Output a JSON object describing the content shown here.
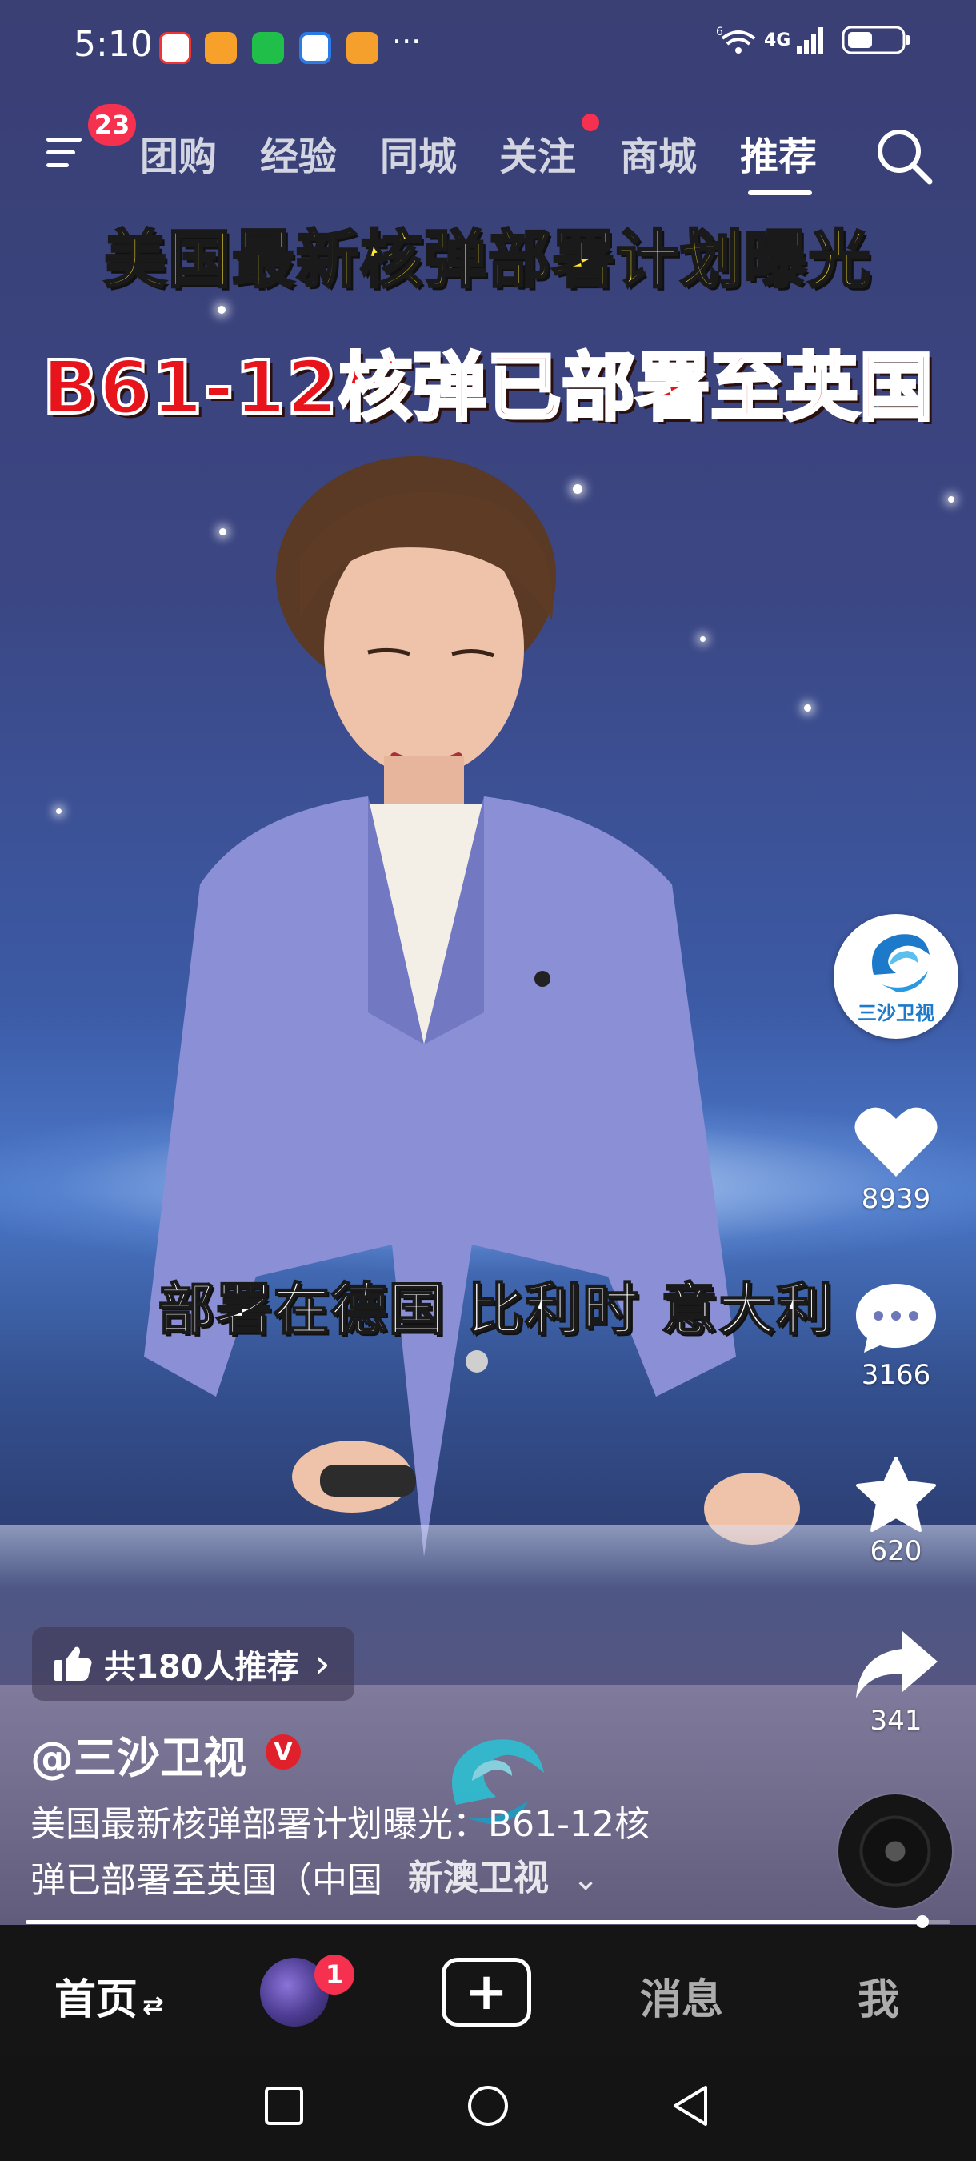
{
  "status_bar": {
    "time": "5:10",
    "app_icons": [
      "clown-app-icon",
      "tasks-app-icon",
      "wechat-icon",
      "browser-app-icon",
      "video-app-icon"
    ],
    "more": "···",
    "network": "4G",
    "wifi_badge": "6",
    "icons": [
      "wifi-icon",
      "signal-icon",
      "battery-icon"
    ]
  },
  "top_nav": {
    "menu_badge": "23",
    "tabs": [
      {
        "label": "团购"
      },
      {
        "label": "经验"
      },
      {
        "label": "同城"
      },
      {
        "label": "关注"
      },
      {
        "label": "商城"
      },
      {
        "label": "推荐"
      }
    ],
    "active_tab": "推荐",
    "colors": {
      "badge": "#f5314f"
    }
  },
  "video": {
    "title_line_1": "美国最新核弹部署计划曝光",
    "title_line_2": "B61-12核弹已部署至英国",
    "subtitle": "部署在德国 比利时 意大利",
    "title_colors": {
      "line_1": "#ffe530",
      "line_2": "#e7141b"
    }
  },
  "actions": {
    "channel_avatar_label": "三沙卫视",
    "likes": "8939",
    "comments": "3166",
    "favorites": "620",
    "shares": "341"
  },
  "recommend": {
    "label": "共180人推荐",
    "arrow": "›"
  },
  "author": {
    "name": "@三沙卫视",
    "verified": "V"
  },
  "caption": {
    "line_1": "美国最新核弹部署计划曝光：B61-12核",
    "line_2": "弹已部署至英国（中国",
    "watermark": "新澳卫视",
    "expand": "⌄"
  },
  "progress": {
    "played_fraction": 0.97
  },
  "bottom_tabs": {
    "home": "首页",
    "home_suffix": "⇄",
    "friend_badge": "1",
    "create": "+",
    "messages": "消息",
    "me": "我"
  }
}
